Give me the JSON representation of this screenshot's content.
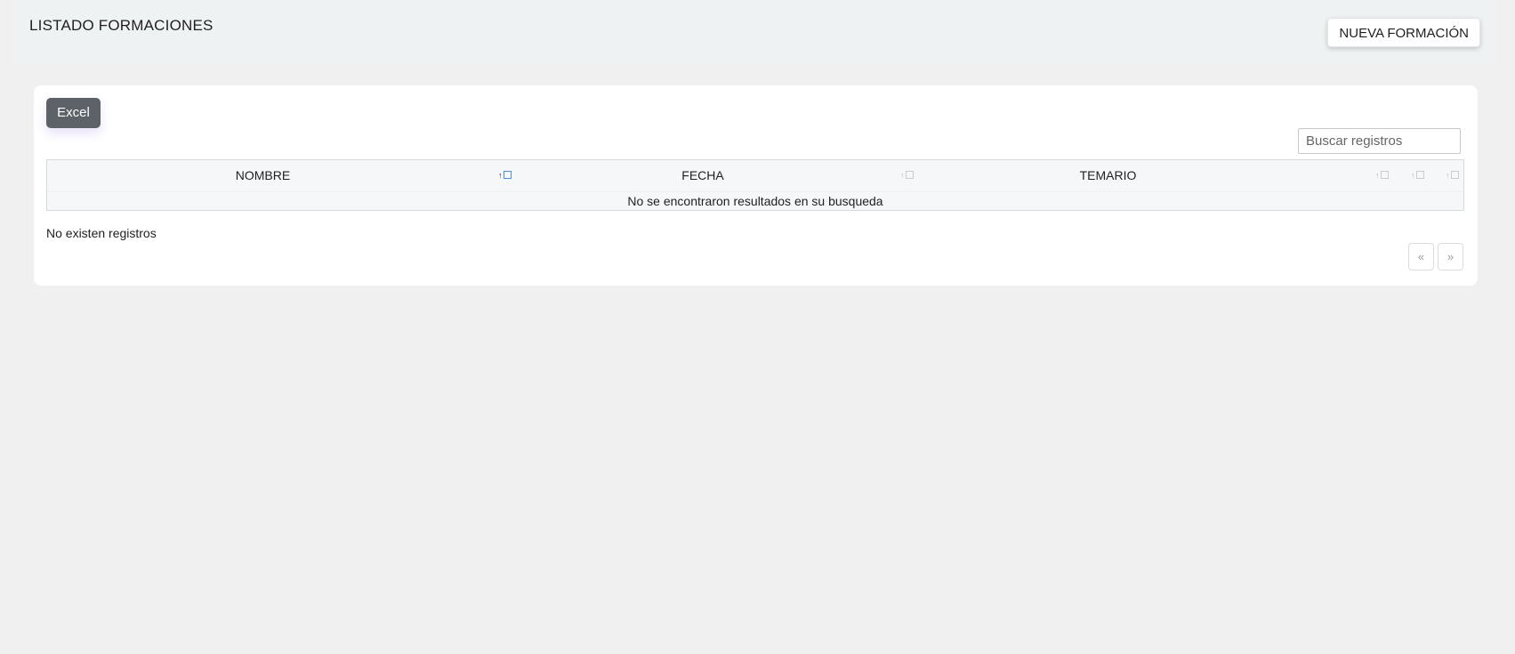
{
  "header": {
    "title": "LISTADO FORMACIONES",
    "new_button_label": "NUEVA FORMACIÓN"
  },
  "toolbar": {
    "excel_label": "Excel"
  },
  "search": {
    "placeholder": "Buscar registros",
    "value": ""
  },
  "table": {
    "columns": [
      {
        "label": "NOMBRE",
        "sort_active": true
      },
      {
        "label": "FECHA",
        "sort_active": false
      },
      {
        "label": "TEMARIO",
        "sort_active": false
      }
    ],
    "extra_sort_columns": 2,
    "empty_message": "No se encontraron resultados en su busqueda"
  },
  "footer": {
    "info": "No existen registros",
    "prev_label": "«",
    "next_label": "»"
  },
  "colors": {
    "page_background": "#eff0ef",
    "excel_button": "#5c6268",
    "active_sort": "#4a90e2"
  }
}
